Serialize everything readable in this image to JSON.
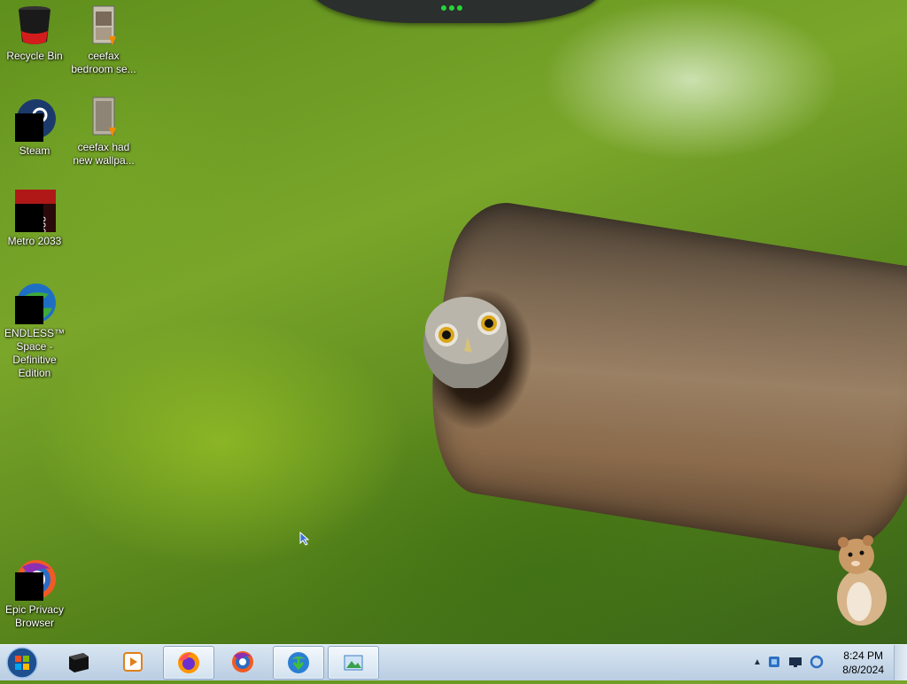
{
  "desktop": {
    "icons": [
      {
        "label": "Recycle Bin",
        "icon": "recycle-bin-icon"
      },
      {
        "label": "ceefax bedroom se...",
        "icon": "video-file-icon"
      },
      {
        "label": "Steam",
        "icon": "steam-icon"
      },
      {
        "label": "ceefax had new wallpa...",
        "icon": "video-file-icon"
      },
      {
        "label": "Metro 2033",
        "icon": "metro-2033-icon"
      },
      {
        "label": "ENDLESS™ Space - Definitive Edition",
        "icon": "endless-space-icon"
      },
      {
        "label": "Epic Privacy Browser",
        "icon": "epic-browser-icon"
      }
    ]
  },
  "taskbar": {
    "start_button": "start-orb-icon",
    "pinned": [
      {
        "name": "black-app",
        "icon": "black-box-icon",
        "active": false
      },
      {
        "name": "media-player",
        "icon": "media-player-icon",
        "active": false
      },
      {
        "name": "firefox",
        "icon": "firefox-icon",
        "active": true
      },
      {
        "name": "epic-browser",
        "icon": "epic-browser-icon",
        "active": false
      },
      {
        "name": "download-manager",
        "icon": "download-manager-icon",
        "active": true
      },
      {
        "name": "image-app",
        "icon": "image-app-icon",
        "active": true
      }
    ],
    "tray": {
      "icons": [
        "chevron-up-icon",
        "network-icon",
        "monitor-icon",
        "sync-icon"
      ],
      "time": "8:24 PM",
      "date": "8/8/2024"
    }
  },
  "colors": {
    "taskbar_top": "#d9e6f2",
    "taskbar_bottom": "#b9cde2",
    "dock_dot": "#27d43a"
  }
}
